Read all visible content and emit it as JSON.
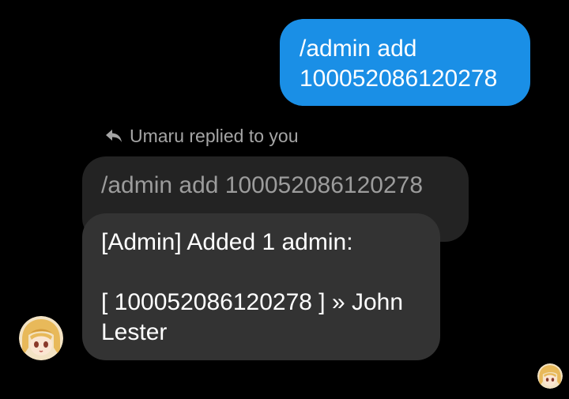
{
  "conversation": {
    "sent_message": {
      "text": "/admin add\n100052086120278"
    },
    "reply_context": {
      "label": "Umaru replied to you",
      "icon": "reply-arrow-icon",
      "quoted_text": "/admin add 100052086120278"
    },
    "reply_message": {
      "line1": "[Admin] Added 1 admin:",
      "line2": "[ 100052086120278 ] » John Lester"
    },
    "sender": {
      "avatar_icon": "anime-avatar-icon"
    },
    "read_receipt": {
      "avatar_icon": "anime-avatar-icon"
    }
  },
  "colors": {
    "background": "#000000",
    "sent_bubble": "#1a8fe6",
    "reply_bubble": "#333333",
    "quoted_bubble": "#232323",
    "muted_text": "#a5a5a5"
  }
}
